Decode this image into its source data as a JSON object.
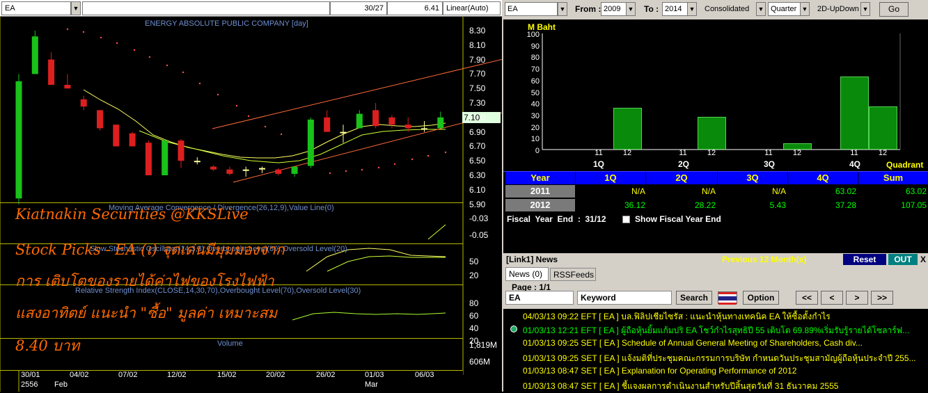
{
  "left": {
    "symbol": "EA",
    "header_count": "30/27",
    "header_price": "6.41",
    "scale_mode": "Linear(Auto)",
    "chart_title": "ENERGY ABSOLUTE PUBLIC COMPANY [day]",
    "y_ticks": [
      "8.30",
      "8.10",
      "7.90",
      "7.70",
      "7.50",
      "7.30",
      "7.10",
      "6.90",
      "6.70",
      "6.50",
      "6.30",
      "6.10",
      "5.90"
    ],
    "current_price": "7.10",
    "macd_title": "Moving Average Convergence / Divergence(26,12,9),Value Line(0)",
    "macd_ticks": [
      "-0.03",
      "-0.05"
    ],
    "stoch_title": "Slow Stochastic Oscillator(14,3,3),Overbought Level(80),Oversold Level(20)",
    "stoch_ticks": [
      "50",
      "20"
    ],
    "rsi_title": "Relative Strength Index(CLOSE,14,30,70),Overbought Level(70),Oversold Level(30)",
    "rsi_ticks": [
      "80",
      "60",
      "40",
      "20"
    ],
    "volume_title": "Volume",
    "volume_ticks": [
      "1,819M",
      "606M"
    ],
    "x_dates": [
      "30/01",
      "04/02",
      "07/02",
      "12/02",
      "15/02",
      "20/02",
      "26/02",
      "01/03",
      "06/03"
    ],
    "x_year": "2556",
    "x_month1": "Feb",
    "x_month2": "Mar",
    "overlay": [
      "Kiatnakin Securities @KKSLive",
      "Stock Picks - EA (เ) จุดเด่นมีมุมมองจาก",
      "การ เติบโตของรายได้ค่าไฟของโรงไฟฟ้า",
      "แสงอาทิตย์ แนะนำ \"ซื้อ\" มูลค่า เหมาะสม",
      "8.40 บาท"
    ]
  },
  "right": {
    "symbol": "EA",
    "from_label": "From :",
    "from_value": "2009",
    "to_label": "To :",
    "to_value": "2014",
    "consolidated": "Consolidated",
    "period": "Quarter",
    "view": "2D-UpDown",
    "go": "Go",
    "unit": "M Baht",
    "y_ticks": [
      "100",
      "90",
      "80",
      "70",
      "60",
      "50",
      "40",
      "30",
      "20",
      "10",
      "0"
    ],
    "quadrant_label": "Quadrant",
    "table": {
      "headers": [
        "Year",
        "1Q",
        "2Q",
        "3Q",
        "4Q",
        "Sum"
      ],
      "rows": [
        {
          "year": "2011",
          "vals": [
            "N/A",
            "N/A",
            "N/A",
            "63.02",
            "63.02"
          ]
        },
        {
          "year": "2012",
          "vals": [
            "36.12",
            "28.22",
            "5.43",
            "37.28",
            "107.05"
          ]
        }
      ]
    },
    "fiscal": "Fiscal  Year  End  :  31/12",
    "show_fiscal": "Show Fiscal Year End",
    "news": {
      "title": "[Link1] News",
      "prev": "Previous 12 Month(s)",
      "reset": "Reset",
      "out": "OUT",
      "close": "X",
      "tab1": "News (0)",
      "tab2": "RSSFeeds",
      "page": "Page : 1/1",
      "symbol": "EA",
      "keyword": "Keyword",
      "search": "Search",
      "option": "Option",
      "nav": [
        "<<",
        "<",
        ">",
        ">>"
      ],
      "items": [
        {
          "date": "04/03/13 09:22",
          "src": "EFT",
          "sym": "[ EA ]",
          "text": "บล.ฟิลิปเชียไซรัส : แนะนำหุ้นทางเทคนิค EA ให้ซื้อตั้งกำไร",
          "color": "#ffff00"
        },
        {
          "date": "01/03/13 12:21",
          "src": "EFT",
          "sym": "[ EA ]",
          "text": "ผู้ถือหุ้นยิ้มแก้มปริ EA โชว์กำไรสุทธิปี 55 เติบโต 69.89%เริ่มรับรู้รายได้โซลาร์ฟ...",
          "color": "#00ff00"
        },
        {
          "date": "01/03/13 09:25",
          "src": "SET",
          "sym": "[ EA ]",
          "text": "Schedule of Annual General Meeting of Shareholders, Cash div...",
          "color": "#ffff00"
        },
        {
          "date": "01/03/13 09:25",
          "src": "SET",
          "sym": "[ EA ]",
          "text": "แจ้งมติที่ประชุมคณะกรรมการบริษัท กำหนดวันประชุมสามัญผู้ถือหุ้นประจำปี 255...",
          "color": "#ffff00"
        },
        {
          "date": "01/03/13 08:47",
          "src": "SET",
          "sym": "[ EA ]",
          "text": "Explanation for Operating Performance of 2012",
          "color": "#ffff00"
        },
        {
          "date": "01/03/13 08:47",
          "src": "SET",
          "sym": "[ EA ]",
          "text": "ชี้แจงผลการดำเนินงานสำหรับปีสิ้นสุดวันที่ 31 ธันวาคม 2555",
          "color": "#ffff00"
        }
      ]
    }
  },
  "chart_data": [
    {
      "type": "bar",
      "title": "",
      "ylabel": "M Baht",
      "xlabel": "Quadrant",
      "ylim": [
        0,
        100
      ],
      "categories": [
        "1Q-11",
        "1Q-12",
        "2Q-11",
        "2Q-12",
        "3Q-11",
        "3Q-12",
        "4Q-11",
        "4Q-12"
      ],
      "groups": [
        "1Q",
        "2Q",
        "3Q",
        "4Q"
      ],
      "sub": [
        "11",
        "12"
      ],
      "values": [
        null,
        36.12,
        null,
        28.22,
        null,
        5.43,
        63.02,
        37.28
      ]
    },
    {
      "type": "candlestick",
      "title": "ENERGY ABSOLUTE PUBLIC COMPANY [day]",
      "ylim": [
        5.9,
        8.3
      ],
      "candles": [
        {
          "o": 5.98,
          "h": 7.7,
          "l": 5.9,
          "c": 7.6
        },
        {
          "o": 7.7,
          "h": 8.3,
          "l": 7.7,
          "c": 8.22
        },
        {
          "o": 7.9,
          "h": 8.0,
          "l": 7.6,
          "c": 7.55
        },
        {
          "o": 7.55,
          "h": 7.7,
          "l": 7.5,
          "c": 7.5
        },
        {
          "o": 7.35,
          "h": 7.4,
          "l": 7.2,
          "c": 7.25
        },
        {
          "o": 7.2,
          "h": 7.2,
          "l": 6.92,
          "c": 6.95
        },
        {
          "o": 7.0,
          "h": 7.0,
          "l": 6.7,
          "c": 6.7
        },
        {
          "o": 6.88,
          "h": 6.9,
          "l": 6.7,
          "c": 6.7
        },
        {
          "o": 6.75,
          "h": 6.78,
          "l": 6.3,
          "c": 6.3
        },
        {
          "o": 6.3,
          "h": 6.8,
          "l": 6.3,
          "c": 6.78
        },
        {
          "o": 6.78,
          "h": 6.8,
          "l": 6.4,
          "c": 6.5
        },
        {
          "o": 6.5,
          "h": 6.55,
          "l": 6.45,
          "c": 6.5
        },
        {
          "o": 6.42,
          "h": 6.44,
          "l": 6.36,
          "c": 6.38
        },
        {
          "o": 6.38,
          "h": 6.42,
          "l": 6.3,
          "c": 6.32
        },
        {
          "o": 6.38,
          "h": 6.42,
          "l": 6.28,
          "c": 6.38
        },
        {
          "o": 6.38,
          "h": 6.42,
          "l": 6.33,
          "c": 6.4
        },
        {
          "o": 6.38,
          "h": 6.4,
          "l": 6.3,
          "c": 6.32
        },
        {
          "o": 6.32,
          "h": 6.42,
          "l": 6.28,
          "c": 6.42
        },
        {
          "o": 6.43,
          "h": 7.1,
          "l": 6.4,
          "c": 7.07
        },
        {
          "o": 7.1,
          "h": 7.2,
          "l": 6.9,
          "c": 6.9
        },
        {
          "o": 6.9,
          "h": 7.0,
          "l": 6.75,
          "c": 6.9
        },
        {
          "o": 6.95,
          "h": 7.2,
          "l": 6.95,
          "c": 7.15
        },
        {
          "o": 7.2,
          "h": 7.3,
          "l": 6.95,
          "c": 6.98
        },
        {
          "o": 7.1,
          "h": 7.13,
          "l": 6.95,
          "c": 7.0
        },
        {
          "o": 7.0,
          "h": 7.1,
          "l": 6.9,
          "c": 6.95
        },
        {
          "o": 6.95,
          "h": 7.05,
          "l": 6.9,
          "c": 6.95
        },
        {
          "o": 6.95,
          "h": 7.18,
          "l": 6.95,
          "c": 7.1
        }
      ]
    }
  ]
}
